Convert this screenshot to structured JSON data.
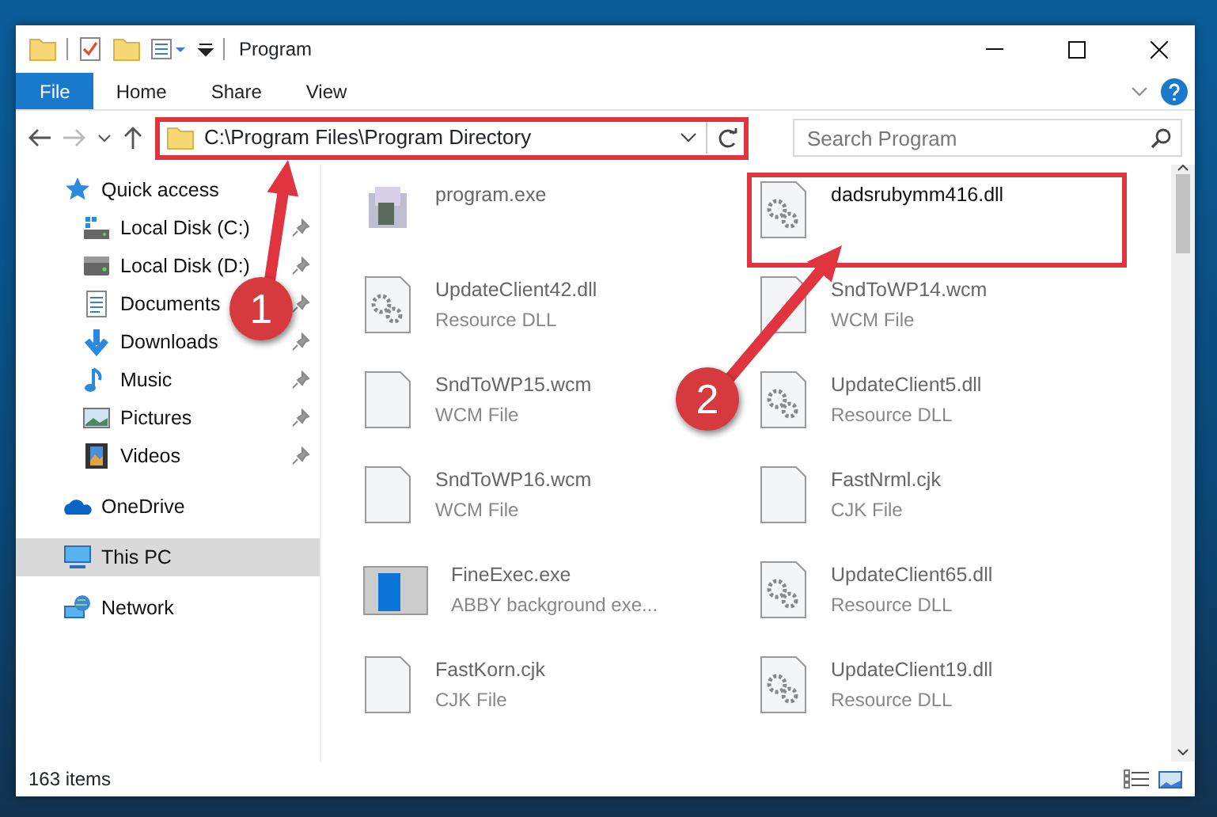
{
  "window": {
    "title": "Program"
  },
  "ribbon": {
    "tabs": [
      {
        "label": "File",
        "selected": true
      },
      {
        "label": "Home",
        "selected": false
      },
      {
        "label": "Share",
        "selected": false
      },
      {
        "label": "View",
        "selected": false
      }
    ]
  },
  "address": {
    "path": "C:\\Program Files\\Program Directory",
    "highlighted": true
  },
  "search": {
    "placeholder": "Search Program"
  },
  "navigation": [
    {
      "label": "Quick access",
      "kind": "star",
      "selected": false,
      "children": [
        {
          "label": "Local Disk (C:)",
          "kind": "drive-c",
          "pinned": true,
          "selected": false
        },
        {
          "label": "Local Disk (D:)",
          "kind": "drive",
          "pinned": true,
          "selected": false
        },
        {
          "label": "Documents",
          "kind": "documents",
          "pinned": true,
          "selected": false
        },
        {
          "label": "Downloads",
          "kind": "downloads",
          "pinned": true,
          "selected": false
        },
        {
          "label": "Music",
          "kind": "music",
          "pinned": true,
          "selected": false
        },
        {
          "label": "Pictures",
          "kind": "pictures",
          "pinned": true,
          "selected": false
        },
        {
          "label": "Videos",
          "kind": "videos",
          "pinned": true,
          "selected": false
        }
      ]
    },
    {
      "label": "OneDrive",
      "kind": "onedrive",
      "selected": false
    },
    {
      "label": "This PC",
      "kind": "pc",
      "selected": true
    },
    {
      "label": "Network",
      "kind": "network",
      "selected": false
    }
  ],
  "files": [
    {
      "name": "program.exe",
      "kind": "exe",
      "faded": true,
      "highlighted": false
    },
    {
      "name": "dadsrubymm416.dll",
      "kind": "dll",
      "faded": false,
      "highlighted": true
    },
    {
      "name": "UpdateClient42.dll",
      "type": "Resource DLL",
      "kind": "dll",
      "faded": true,
      "highlighted": false
    },
    {
      "name": "SndToWP14.wcm",
      "type": "WCM File",
      "kind": "file",
      "faded": true,
      "highlighted": false
    },
    {
      "name": "SndToWP15.wcm",
      "type": "WCM File",
      "kind": "file",
      "faded": true,
      "highlighted": false
    },
    {
      "name": "UpdateClient5.dll",
      "type": "Resource DLL",
      "kind": "dll",
      "faded": true,
      "highlighted": false
    },
    {
      "name": "SndToWP16.wcm",
      "type": "WCM File",
      "kind": "file",
      "faded": true,
      "highlighted": false
    },
    {
      "name": "FastNrml.cjk",
      "type": "CJK File",
      "kind": "file",
      "faded": true,
      "highlighted": false
    },
    {
      "name": "FineExec.exe",
      "type": "ABBY background exe...",
      "kind": "app",
      "faded": true,
      "highlighted": false
    },
    {
      "name": "UpdateClient65.dll",
      "type": "Resource DLL",
      "kind": "dll",
      "faded": true,
      "highlighted": false
    },
    {
      "name": "FastKorn.cjk",
      "type": "CJK File",
      "kind": "file",
      "faded": true,
      "highlighted": false
    },
    {
      "name": "UpdateClient19.dll",
      "type": "Resource DLL",
      "kind": "dll",
      "faded": true,
      "highlighted": false
    }
  ],
  "status_bar": {
    "item_count": "163 items"
  },
  "callouts": [
    {
      "number": "1"
    },
    {
      "number": "2"
    }
  ]
}
